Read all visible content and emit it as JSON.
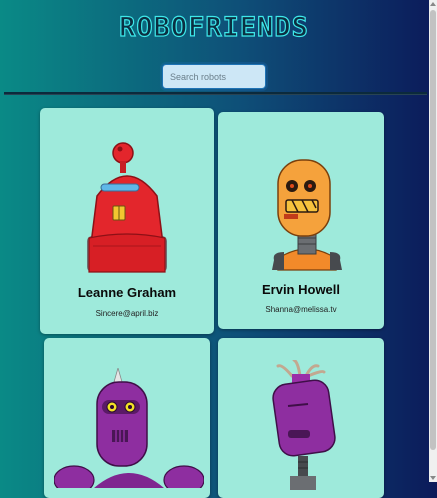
{
  "app": {
    "title": "ROBOFRIENDS"
  },
  "search": {
    "placeholder": "Search robots",
    "value": ""
  },
  "robots": [
    {
      "name": "Leanne Graham",
      "email": "Sincere@april.biz"
    },
    {
      "name": "Ervin Howell",
      "email": "Shanna@melissa.tv"
    },
    {
      "name": "",
      "email": ""
    },
    {
      "name": "",
      "email": ""
    }
  ]
}
